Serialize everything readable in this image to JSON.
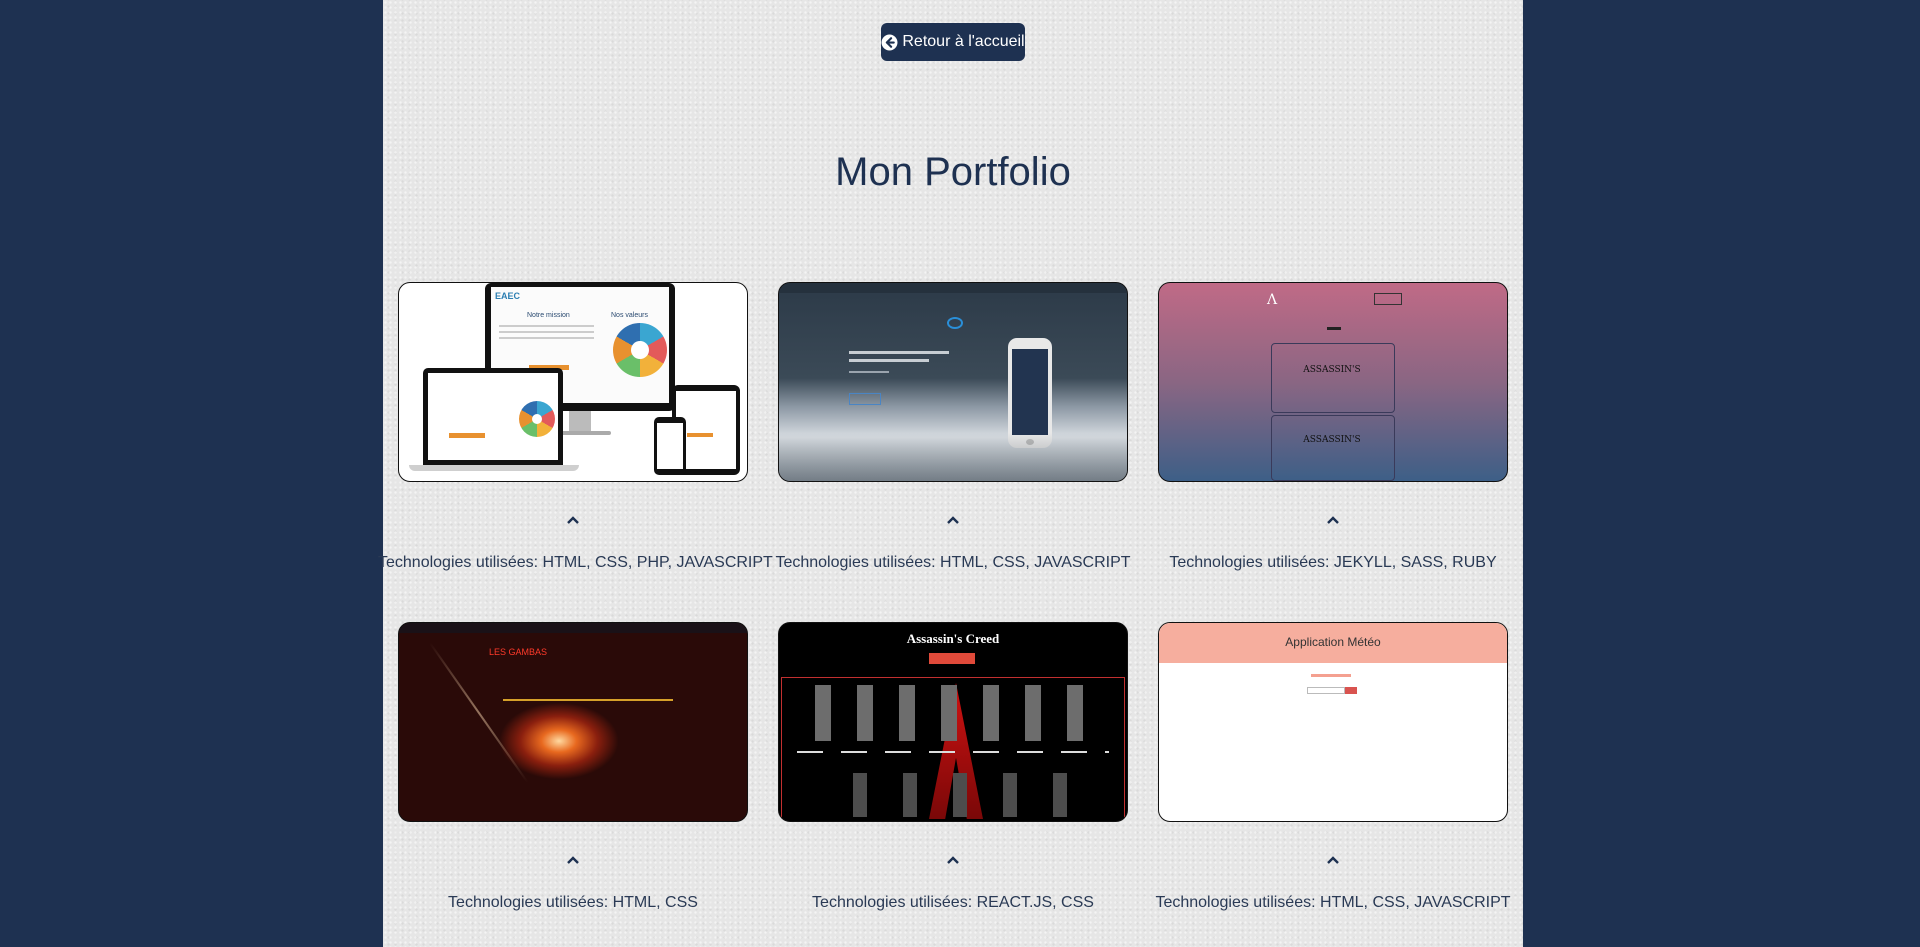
{
  "nav": {
    "back_label": "Retour à l'accueil"
  },
  "title": "Mon Portfolio",
  "projects": [
    {
      "tech": "Technologies utilisées: HTML, CSS, PHP, JAVASCRIPT",
      "preview": {
        "brand": "EAEC",
        "heading_a": "Notre mission",
        "heading_b": "Nos valeurs"
      }
    },
    {
      "tech": "Technologies utilisées: HTML, CSS, JAVASCRIPT"
    },
    {
      "tech": "Technologies utilisées: JEKYLL, SASS, RUBY",
      "preview": {
        "card_text": "ASSASSIN'S"
      }
    },
    {
      "tech": "Technologies utilisées: HTML, CSS",
      "preview": {
        "heading": "LES GAMBAS"
      }
    },
    {
      "tech": "Technologies utilisées: REACT.JS, CSS",
      "preview": {
        "title": "Assassin's Creed"
      }
    },
    {
      "tech": "Technologies utilisées: HTML, CSS, JAVASCRIPT",
      "preview": {
        "title": "Application Météo"
      }
    }
  ]
}
